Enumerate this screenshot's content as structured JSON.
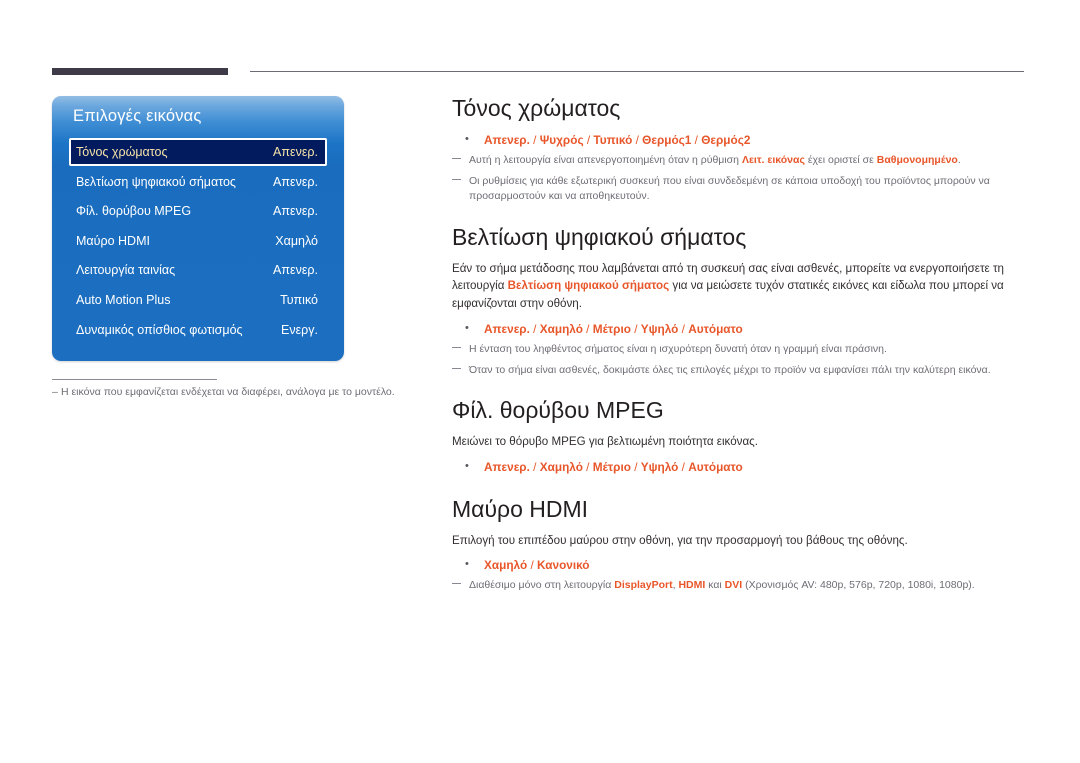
{
  "header": {
    "rule_thick_color": "#3f3a48",
    "rule_thin_color": "#6d6a73"
  },
  "osd": {
    "title": "Επιλογές εικόνας",
    "panel_color": "#1c6fc0",
    "selected_row_color": "#021a5e",
    "selected_text_color": "#f6e3a8",
    "rows": [
      {
        "label": "Τόνος χρώματος",
        "value": "Απενερ.",
        "selected": true
      },
      {
        "label": "Βελτίωση ψηφιακού σήματος",
        "value": "Απενερ.",
        "selected": false
      },
      {
        "label": "Φίλ. θορύβου MPEG",
        "value": "Απενερ.",
        "selected": false
      },
      {
        "label": "Μαύρο HDMI",
        "value": "Χαμηλό",
        "selected": false
      },
      {
        "label": "Λειτουργία ταινίας",
        "value": "Απενερ.",
        "selected": false
      },
      {
        "label": "Auto Motion Plus",
        "value": "Τυπικό",
        "selected": false
      },
      {
        "label": "Δυναμικός οπίσθιος φωτισμός",
        "value": "Ενεργ.",
        "selected": false
      }
    ],
    "footnote_dash": "–",
    "footnote": "Η εικόνα που εμφανίζεται ενδέχεται να διαφέρει, ανάλογα με το μοντέλο."
  },
  "accent_color": "#e8562a",
  "sections": [
    {
      "heading": "Τόνος χρώματος",
      "paragraphs": [],
      "options": [
        {
          "bullet": "•",
          "parts": [
            {
              "text": "Απενερ.",
              "type": "opt"
            },
            {
              "text": " / ",
              "type": "sep"
            },
            {
              "text": "Ψυχρός",
              "type": "opt"
            },
            {
              "text": " / ",
              "type": "sep"
            },
            {
              "text": "Τυπικό",
              "type": "opt"
            },
            {
              "text": " / ",
              "type": "sep"
            },
            {
              "text": "Θερμός1",
              "type": "opt"
            },
            {
              "text": " / ",
              "type": "sep"
            },
            {
              "text": "Θερμός2",
              "type": "opt"
            }
          ]
        }
      ],
      "notes": [
        {
          "parts": [
            {
              "text": "Αυτή η λειτουργία είναι απενεργοποιημένη όταν η ρύθμιση ",
              "type": "plain"
            },
            {
              "text": "Λειτ. εικόνας",
              "type": "hl"
            },
            {
              "text": " έχει οριστεί σε ",
              "type": "plain"
            },
            {
              "text": "Βαθμονομημένο",
              "type": "hl"
            },
            {
              "text": ".",
              "type": "plain"
            }
          ]
        },
        {
          "parts": [
            {
              "text": "Οι ρυθμίσεις για κάθε εξωτερική συσκευή που είναι συνδεδεμένη σε κάποια υποδοχή του προϊόντος μπορούν να προσαρμοστούν και να αποθηκευτούν.",
              "type": "plain"
            }
          ]
        }
      ]
    },
    {
      "heading": "Βελτίωση ψηφιακού σήματος",
      "paragraphs": [
        {
          "parts": [
            {
              "text": "Εάν το σήμα μετάδοσης που λαμβάνεται από τη συσκευή σας είναι ασθενές, μπορείτε να ενεργοποιήσετε τη λειτουργία ",
              "type": "plain"
            },
            {
              "text": "Βελτίωση ψηφιακού σήματος",
              "type": "hl"
            },
            {
              "text": " για να μειώσετε τυχόν στατικές εικόνες και είδωλα που μπορεί να εμφανίζονται στην οθόνη.",
              "type": "plain"
            }
          ]
        }
      ],
      "options": [
        {
          "bullet": "•",
          "parts": [
            {
              "text": "Απενερ.",
              "type": "opt"
            },
            {
              "text": " / ",
              "type": "sep"
            },
            {
              "text": "Χαμηλό",
              "type": "opt"
            },
            {
              "text": " / ",
              "type": "sep"
            },
            {
              "text": "Μέτριο",
              "type": "opt"
            },
            {
              "text": " / ",
              "type": "sep"
            },
            {
              "text": "Υψηλό",
              "type": "opt"
            },
            {
              "text": " / ",
              "type": "sep"
            },
            {
              "text": "Αυτόματο",
              "type": "opt"
            }
          ]
        }
      ],
      "notes": [
        {
          "parts": [
            {
              "text": "Η ένταση του ληφθέντος σήματος είναι η ισχυρότερη δυνατή όταν η γραμμή είναι πράσινη.",
              "type": "plain"
            }
          ]
        },
        {
          "parts": [
            {
              "text": "Όταν το σήμα είναι ασθενές, δοκιμάστε όλες τις επιλογές μέχρι το προϊόν να εμφανίσει πάλι την καλύτερη εικόνα.",
              "type": "plain"
            }
          ]
        }
      ]
    },
    {
      "heading": "Φίλ. θορύβου MPEG",
      "paragraphs": [
        {
          "parts": [
            {
              "text": "Μειώνει το θόρυβο MPEG για βελτιωμένη ποιότητα εικόνας.",
              "type": "plain"
            }
          ]
        }
      ],
      "options": [
        {
          "bullet": "•",
          "parts": [
            {
              "text": "Απενερ.",
              "type": "opt"
            },
            {
              "text": " / ",
              "type": "sep"
            },
            {
              "text": "Χαμηλό",
              "type": "opt"
            },
            {
              "text": " / ",
              "type": "sep"
            },
            {
              "text": "Μέτριο",
              "type": "opt"
            },
            {
              "text": " / ",
              "type": "sep"
            },
            {
              "text": "Υψηλό",
              "type": "opt"
            },
            {
              "text": " / ",
              "type": "sep"
            },
            {
              "text": "Αυτόματο",
              "type": "opt"
            }
          ]
        }
      ],
      "notes": []
    },
    {
      "heading": "Μαύρο HDMI",
      "paragraphs": [
        {
          "parts": [
            {
              "text": "Επιλογή του επιπέδου μαύρου στην οθόνη, για την προσαρμογή του βάθους της οθόνης.",
              "type": "plain"
            }
          ]
        }
      ],
      "options": [
        {
          "bullet": "•",
          "parts": [
            {
              "text": "Χαμηλό",
              "type": "opt"
            },
            {
              "text": " / ",
              "type": "sep"
            },
            {
              "text": "Κανονικό",
              "type": "opt"
            }
          ]
        }
      ],
      "notes": [
        {
          "parts": [
            {
              "text": "Διαθέσιμο μόνο στη λειτουργία ",
              "type": "plain"
            },
            {
              "text": "DisplayPort",
              "type": "hl"
            },
            {
              "text": ", ",
              "type": "plain"
            },
            {
              "text": "HDMI",
              "type": "hl"
            },
            {
              "text": " και ",
              "type": "plain"
            },
            {
              "text": "DVI",
              "type": "hl"
            },
            {
              "text": " (Χρονισμός AV: 480p, 576p, 720p, 1080i, 1080p).",
              "type": "plain"
            }
          ]
        }
      ]
    }
  ]
}
